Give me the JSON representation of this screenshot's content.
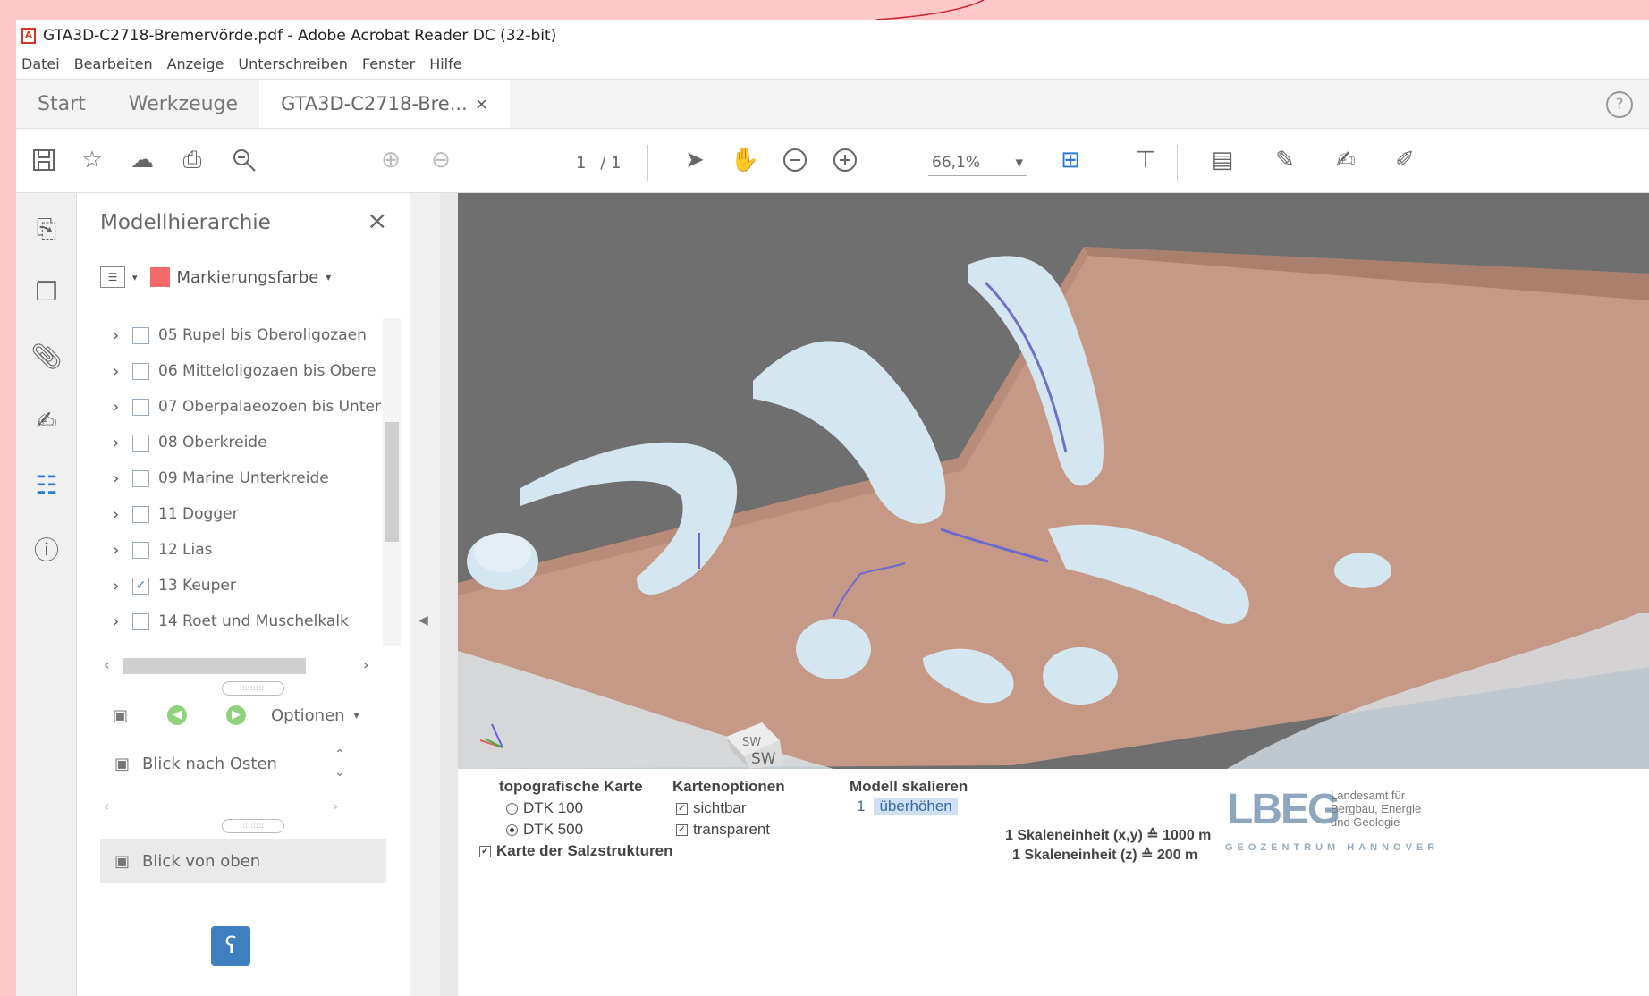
{
  "window": {
    "title": "GTA3D-C2718-Bremervörde.pdf - Adobe Acrobat Reader DC (32-bit)",
    "pdf_icon": "A"
  },
  "menu": [
    "Datei",
    "Bearbeiten",
    "Anzeige",
    "Unterschreiben",
    "Fenster",
    "Hilfe"
  ],
  "tabs": {
    "start": "Start",
    "tools": "Werkzeuge",
    "document": "GTA3D-C2718-Bre...",
    "close": "×",
    "help": "?"
  },
  "toolbar": {
    "page_current": "1",
    "page_total": "/ 1",
    "zoom": "66,1%",
    "zoom_arrow": "▾",
    "icons": [
      "save-icon",
      "bookmark-star-icon",
      "upload-cloud-icon",
      "print-icon",
      "zoom-search-icon",
      "page-up-icon",
      "page-down-icon",
      "select-cursor-icon",
      "hand-tool-icon",
      "zoom-out-icon",
      "zoom-in-icon",
      "fit-page-icon",
      "measure-icon",
      "comment-icon",
      "highlight-pen-icon",
      "sign-icon",
      "fill-sign-icon"
    ]
  },
  "panel": {
    "title": "Modellhierarchie",
    "close": "×",
    "marker_label": "Markierungsfarbe",
    "marker_color": "#f46a6a",
    "items": [
      {
        "label": "05 Rupel bis Oberoligozaen",
        "checked": false
      },
      {
        "label": "06 Mitteloligozaen bis Obere",
        "checked": false
      },
      {
        "label": "07 Oberpalaeozoen bis Unter",
        "checked": false
      },
      {
        "label": "08 Oberkreide",
        "checked": false
      },
      {
        "label": "09 Marine Unterkreide",
        "checked": false
      },
      {
        "label": "11 Dogger",
        "checked": false
      },
      {
        "label": "12 Lias",
        "checked": false
      },
      {
        "label": "13 Keuper",
        "checked": true
      },
      {
        "label": "14 Roet und Muschelkalk",
        "checked": false
      }
    ],
    "options_label": "Optionen",
    "views": [
      "Blick nach Osten",
      "Blick von oben"
    ]
  },
  "scene": {
    "nav_cube_top": "SW",
    "nav_cube_front": "SW"
  },
  "legend": {
    "topo_title": "topografische Karte",
    "dtk100": "DTK 100",
    "dtk500": "DTK 500",
    "salt_map": "Karte der Salzstrukturen",
    "map_options_title": "Kartenoptionen",
    "visible": "sichtbar",
    "transparent": "transparent",
    "scale_title": "Modell skalieren",
    "scale_value": "1",
    "scale_button": "überhöhen",
    "unit_xy": "1 Skaleneinheit (x,y) ≙ 1000 m",
    "unit_z": "1 Skaleneinheit (z) ≙ 200 m",
    "lbeg_logo": "LBEG",
    "lbeg_line1": "Landesamt für",
    "lbeg_line2": "Bergbau, Energie",
    "lbeg_line3": "und Geologie",
    "geozentrum": "GEOZENTRUM HANNOVER"
  }
}
